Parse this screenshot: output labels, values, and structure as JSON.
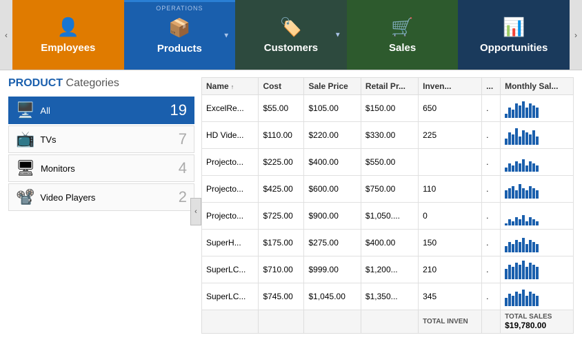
{
  "nav": {
    "left_arrow": "‹",
    "right_arrow": "›",
    "operations_label": "OPERATIONS",
    "items": [
      {
        "id": "employees",
        "label": "Employees",
        "icon": "👤",
        "class": "employees",
        "dropdown": false
      },
      {
        "id": "products",
        "label": "Products",
        "icon": "📦",
        "class": "products-wrapper",
        "dropdown": true,
        "operations": true
      },
      {
        "id": "customers",
        "label": "Customers",
        "icon": "🏷️",
        "class": "customers",
        "dropdown": true
      },
      {
        "id": "sales",
        "label": "Sales",
        "icon": "🛒",
        "class": "sales",
        "dropdown": false
      },
      {
        "id": "opportunities",
        "label": "Opportunities",
        "icon": "📊",
        "class": "opportunities",
        "dropdown": false
      }
    ]
  },
  "section": {
    "title_highlight": "PRODUCT",
    "title_normal": " Categories"
  },
  "categories": [
    {
      "id": "all",
      "name": "All",
      "count": 19,
      "icon": "🖥️",
      "active": true
    },
    {
      "id": "tvs",
      "name": "TVs",
      "count": 7,
      "icon": "📺",
      "active": false
    },
    {
      "id": "monitors",
      "name": "Monitors",
      "count": 4,
      "icon": "🖥",
      "active": false
    },
    {
      "id": "video-players",
      "name": "Video Players",
      "count": 2,
      "icon": "📽️",
      "active": false
    }
  ],
  "table": {
    "columns": [
      {
        "id": "name",
        "label": "Name",
        "sortable": true
      },
      {
        "id": "cost",
        "label": "Cost"
      },
      {
        "id": "sale_price",
        "label": "Sale Price"
      },
      {
        "id": "retail_price",
        "label": "Retail Pr..."
      },
      {
        "id": "inventory",
        "label": "Inven..."
      },
      {
        "id": "dot",
        "label": "..."
      },
      {
        "id": "monthly_sales",
        "label": "Monthly Sal..."
      }
    ],
    "rows": [
      {
        "name": "ExcelRe...",
        "cost": "$55.00",
        "sale_price": "$105.00",
        "retail_price": "$150.00",
        "inventory": "650",
        "dot": ".",
        "bars": [
          2,
          5,
          4,
          7,
          6,
          8,
          5,
          7,
          6,
          5
        ]
      },
      {
        "name": "HD Vide...",
        "cost": "$110.00",
        "sale_price": "$220.00",
        "retail_price": "$330.00",
        "inventory": "225",
        "dot": ".",
        "bars": [
          3,
          6,
          5,
          8,
          4,
          7,
          6,
          5,
          7,
          4
        ]
      },
      {
        "name": "Projecto...",
        "cost": "$225.00",
        "sale_price": "$400.00",
        "retail_price": "$550.00",
        "inventory": "",
        "dot": ".",
        "bars": [
          2,
          4,
          3,
          5,
          4,
          6,
          3,
          5,
          4,
          3
        ]
      },
      {
        "name": "Projecto...",
        "cost": "$425.00",
        "sale_price": "$600.00",
        "retail_price": "$750.00",
        "inventory": "110",
        "dot": ".",
        "bars": [
          4,
          5,
          6,
          4,
          7,
          5,
          4,
          6,
          5,
          4
        ]
      },
      {
        "name": "Projecto...",
        "cost": "$725.00",
        "sale_price": "$900.00",
        "retail_price": "$1,050....",
        "inventory": "0",
        "dot": ".",
        "bars": [
          1,
          3,
          2,
          4,
          3,
          5,
          2,
          4,
          3,
          2
        ]
      },
      {
        "name": "SuperH...",
        "cost": "$175.00",
        "sale_price": "$275.00",
        "retail_price": "$400.00",
        "inventory": "150",
        "dot": ".",
        "bars": [
          3,
          5,
          4,
          6,
          5,
          7,
          4,
          6,
          5,
          4
        ]
      },
      {
        "name": "SuperLC...",
        "cost": "$710.00",
        "sale_price": "$999.00",
        "retail_price": "$1,200...",
        "inventory": "210",
        "dot": ".",
        "bars": [
          5,
          7,
          6,
          8,
          7,
          9,
          6,
          8,
          7,
          6
        ]
      },
      {
        "name": "SuperLC...",
        "cost": "$745.00",
        "sale_price": "$1,045.00",
        "retail_price": "$1,350...",
        "inventory": "345",
        "dot": ".",
        "bars": [
          4,
          6,
          5,
          7,
          6,
          8,
          5,
          7,
          6,
          5
        ]
      }
    ],
    "footer": {
      "label_inventory": "TOTAL INVEN",
      "label_sales": "TOTAL SALES",
      "total_sales": "$19,780.00"
    }
  },
  "collapse_btn": "‹"
}
